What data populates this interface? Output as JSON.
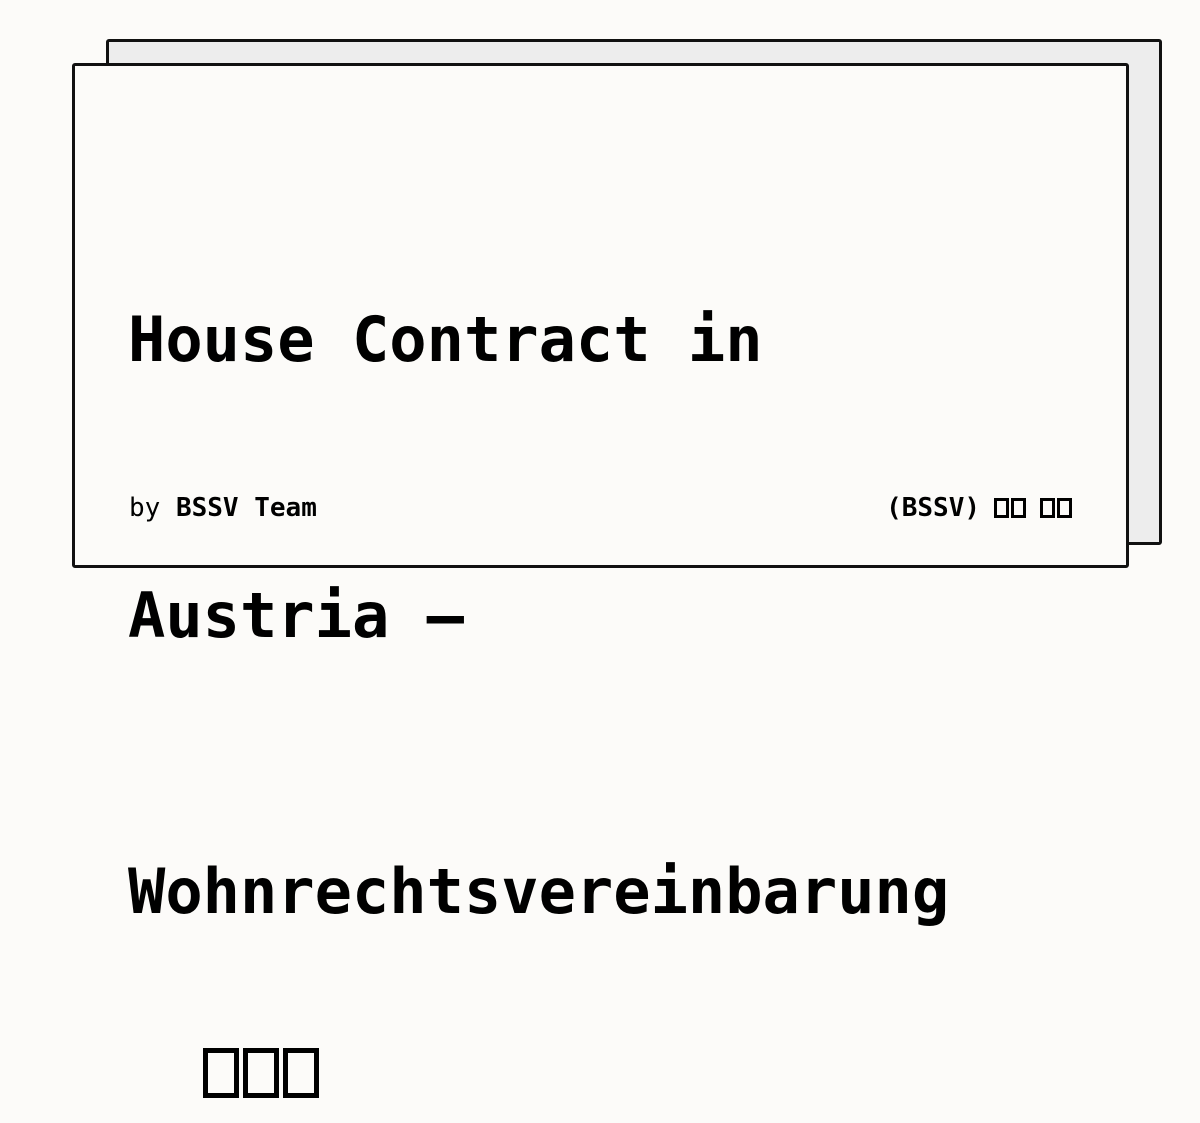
{
  "card": {
    "title_lines": [
      "House Contract in",
      "Austria –",
      "Wohnrechtsvereinbarung"
    ],
    "title_trailing_glyphs": "□□□",
    "byline_prefix": "by",
    "author": "BSSV Team",
    "org_label": "(BSSV)",
    "org_trailing_glyphs": "□□ □□"
  }
}
